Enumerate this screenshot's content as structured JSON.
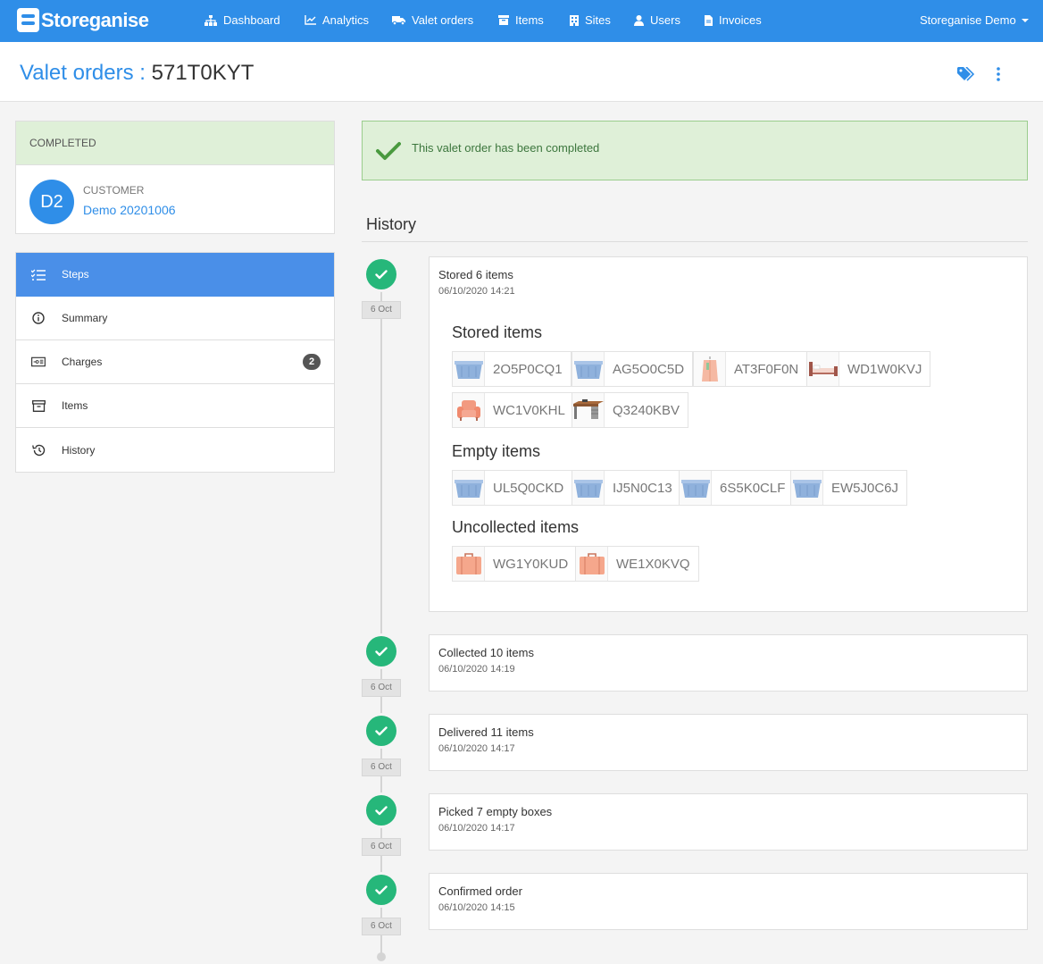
{
  "brand": {
    "name": "Storeganise"
  },
  "nav": {
    "items": [
      {
        "label": "Dashboard",
        "icon": "sitemap-icon"
      },
      {
        "label": "Analytics",
        "icon": "chart-icon"
      },
      {
        "label": "Valet orders",
        "icon": "truck-icon"
      },
      {
        "label": "Items",
        "icon": "archive-icon"
      },
      {
        "label": "Sites",
        "icon": "building-icon"
      },
      {
        "label": "Users",
        "icon": "user-icon"
      },
      {
        "label": "Invoices",
        "icon": "file-icon"
      }
    ],
    "user_menu": "Storeganise Demo"
  },
  "header": {
    "crumb": "Valet orders",
    "separator": " : ",
    "order_id": "571T0KYT"
  },
  "status": {
    "label": "COMPLETED"
  },
  "customer": {
    "initials": "D2",
    "label": "CUSTOMER",
    "name": "Demo 20201006"
  },
  "menu": {
    "items": [
      {
        "label": "Steps",
        "icon": "list-check-icon",
        "active": true
      },
      {
        "label": "Summary",
        "icon": "info-icon"
      },
      {
        "label": "Charges",
        "icon": "money-icon",
        "badge": "2"
      },
      {
        "label": "Items",
        "icon": "archive-icon"
      },
      {
        "label": "History",
        "icon": "history-icon"
      }
    ]
  },
  "alert": {
    "text": "This valet order has been completed"
  },
  "history": {
    "title": "History",
    "events": [
      {
        "title": "Stored 6 items",
        "time": "06/10/2020 14:21",
        "date": "6 Oct",
        "sections": [
          {
            "title": "Stored items",
            "items": [
              {
                "code": "2O5P0CQ1",
                "type": "box"
              },
              {
                "code": "AG5O0C5D",
                "type": "box"
              },
              {
                "code": "AT3F0F0N",
                "type": "bag"
              },
              {
                "code": "WD1W0KVJ",
                "type": "bed"
              },
              {
                "code": "WC1V0KHL",
                "type": "armchair"
              },
              {
                "code": "Q3240KBV",
                "type": "desk"
              }
            ]
          },
          {
            "title": "Empty items",
            "items": [
              {
                "code": "UL5Q0CKD",
                "type": "box"
              },
              {
                "code": "IJ5N0C13",
                "type": "box"
              },
              {
                "code": "6S5K0CLF",
                "type": "box"
              },
              {
                "code": "EW5J0C6J",
                "type": "box"
              }
            ]
          },
          {
            "title": "Uncollected items",
            "items": [
              {
                "code": "WG1Y0KUD",
                "type": "suitcase"
              },
              {
                "code": "WE1X0KVQ",
                "type": "suitcase"
              }
            ]
          }
        ]
      },
      {
        "title": "Collected 10 items",
        "time": "06/10/2020 14:19",
        "date": "6 Oct"
      },
      {
        "title": "Delivered 11 items",
        "time": "06/10/2020 14:17",
        "date": "6 Oct"
      },
      {
        "title": "Picked 7 empty boxes",
        "time": "06/10/2020 14:17",
        "date": "6 Oct"
      },
      {
        "title": "Confirmed order",
        "time": "06/10/2020 14:15",
        "date": "6 Oct"
      }
    ]
  },
  "colors": {
    "primary": "#2f8ee8",
    "success": "#26b77a",
    "alert_bg": "#dff0d8",
    "alert_text": "#3c763d",
    "item_box": "#8fb1dc",
    "item_salmon": "#f0a58a"
  }
}
